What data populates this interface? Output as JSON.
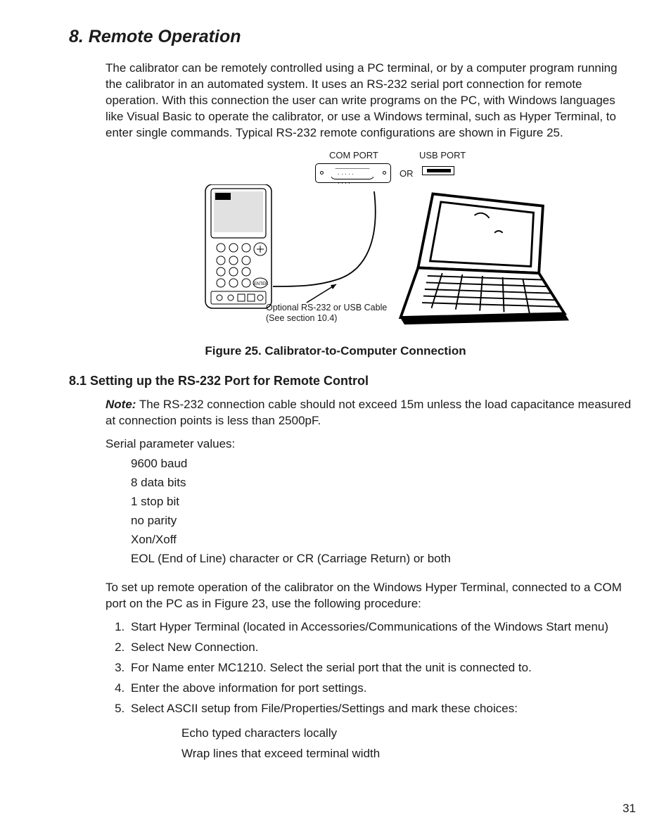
{
  "section": {
    "title": "8. Remote Operation",
    "intro": "The calibrator can be remotely controlled using a PC terminal, or by a computer program running the calibrator in an automated system. It uses an RS-232 serial port connection for remote operation. With this connection the user can write programs on the PC, with Windows languages like Visual Basic to operate the calibrator, or use a Windows terminal, such as Hyper Terminal, to enter single commands. Typical RS-232 remote configurations are shown in Figure 25."
  },
  "figure": {
    "com_label": "COM PORT",
    "usb_label": "USB PORT",
    "or": "OR",
    "cable_note": "Optional RS-232 or USB Cable\n(See section 10.4)",
    "caption": "Figure 25. Calibrator-to-Computer Connection"
  },
  "subsection": {
    "title": "8.1 Setting up the RS-232 Port for Remote Control",
    "note_label": "Note:",
    "note_text": "The RS-232 connection cable should not exceed 15m unless the load capacitance measured at connection points is less than 2500pF.",
    "params_label": "Serial parameter values:",
    "params": [
      "9600 baud",
      "8 data bits",
      "1 stop bit",
      "no parity",
      "Xon/Xoff",
      "EOL (End of Line) character or CR (Carriage Return) or both"
    ],
    "procedure_intro": "To set up remote operation of the calibrator on the Windows Hyper Terminal, connected to a COM port on the PC as in Figure 23, use the following procedure:",
    "steps": [
      "Start Hyper Terminal (located in Accessories/Communications of the Windows Start menu)",
      "Select New Connection.",
      "For Name enter MC1210. Select the serial port that the unit is connected to.",
      "Enter the above information for port settings.",
      "Select ASCII setup from File/Properties/Settings and mark these choices:"
    ],
    "substeps": [
      "Echo typed characters locally",
      "Wrap lines that exceed terminal width"
    ]
  },
  "page_number": "31"
}
